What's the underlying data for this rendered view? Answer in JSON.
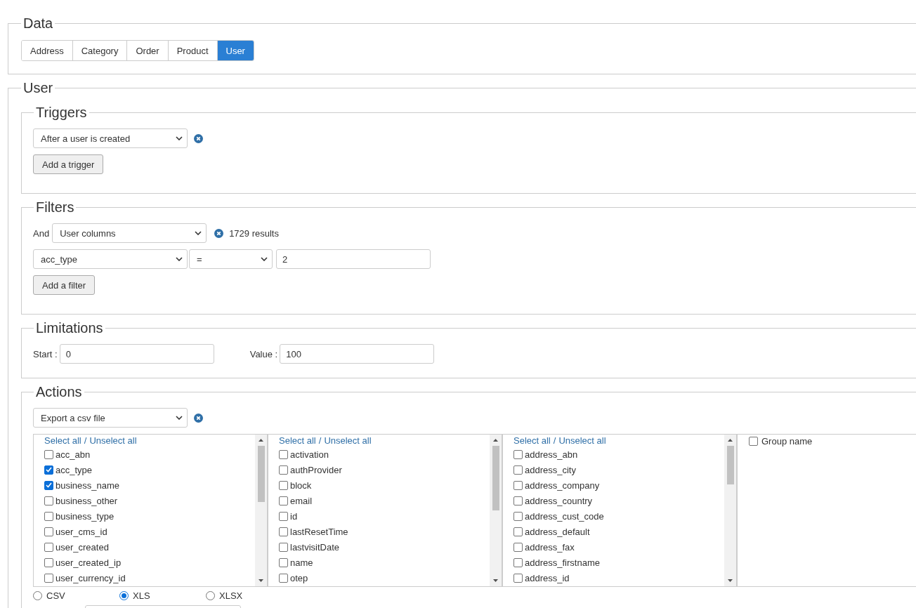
{
  "data": {
    "legend": "Data",
    "tabs": [
      {
        "label": "Address",
        "selected": false
      },
      {
        "label": "Category",
        "selected": false
      },
      {
        "label": "Order",
        "selected": false
      },
      {
        "label": "Product",
        "selected": false
      },
      {
        "label": "User",
        "selected": true
      }
    ]
  },
  "user": {
    "legend": "User",
    "triggers": {
      "legend": "Triggers",
      "select": "After a user is created",
      "button": "Add a trigger"
    },
    "filters": {
      "legend": "Filters",
      "conjunction": "And",
      "column_group": "User columns",
      "results": "1729 results",
      "rows": [
        {
          "column": "acc_type",
          "operator": "=",
          "value": "2"
        }
      ],
      "button": "Add a filter"
    },
    "limitations": {
      "legend": "Limitations",
      "fields": [
        {
          "label": "Start :",
          "value": "0"
        },
        {
          "label": "Value :",
          "value": "100"
        }
      ]
    },
    "actions": {
      "legend": "Actions",
      "select": "Export a csv file",
      "column_lists": [
        {
          "select_all": "Select all",
          "separator": "/",
          "unselect_all": "Unselect all",
          "items": [
            {
              "label": "acc_abn",
              "checked": false
            },
            {
              "label": "acc_type",
              "checked": true
            },
            {
              "label": "business_name",
              "checked": true
            },
            {
              "label": "business_other",
              "checked": false
            },
            {
              "label": "business_type",
              "checked": false
            },
            {
              "label": "user_cms_id",
              "checked": false
            },
            {
              "label": "user_created",
              "checked": false
            },
            {
              "label": "user_created_ip",
              "checked": false
            },
            {
              "label": "user_currency_id",
              "checked": false
            }
          ]
        },
        {
          "select_all": "Select all",
          "separator": "/",
          "unselect_all": "Unselect all",
          "items": [
            {
              "label": "activation",
              "checked": false
            },
            {
              "label": "authProvider",
              "checked": false
            },
            {
              "label": "block",
              "checked": false
            },
            {
              "label": "email",
              "checked": false
            },
            {
              "label": "id",
              "checked": false
            },
            {
              "label": "lastResetTime",
              "checked": false
            },
            {
              "label": "lastvisitDate",
              "checked": false
            },
            {
              "label": "name",
              "checked": false
            },
            {
              "label": "otep",
              "checked": false
            }
          ]
        },
        {
          "select_all": "Select all",
          "separator": "/",
          "unselect_all": "Unselect all",
          "items": [
            {
              "label": "address_abn",
              "checked": false
            },
            {
              "label": "address_city",
              "checked": false
            },
            {
              "label": "address_company",
              "checked": false
            },
            {
              "label": "address_country",
              "checked": false
            },
            {
              "label": "address_cust_code",
              "checked": false
            },
            {
              "label": "address_default",
              "checked": false
            },
            {
              "label": "address_fax",
              "checked": false
            },
            {
              "label": "address_firstname",
              "checked": false
            },
            {
              "label": "address_id",
              "checked": false
            }
          ]
        }
      ],
      "group_option": {
        "label": "Group name",
        "checked": false
      },
      "formats": [
        {
          "label": "CSV",
          "selected": false
        },
        {
          "label": "XLS",
          "selected": true
        },
        {
          "label": "XLSX",
          "selected": false
        }
      ]
    }
  }
}
